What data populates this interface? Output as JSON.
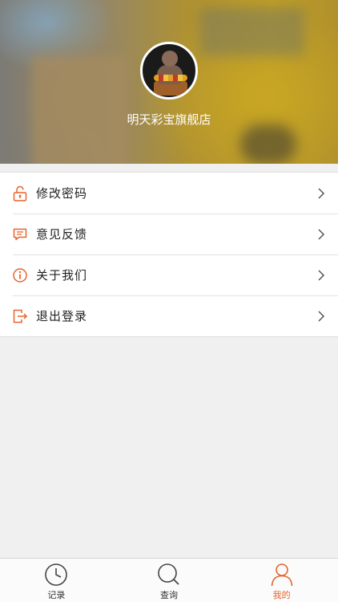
{
  "profile": {
    "store_name": "明天彩宝旗舰店"
  },
  "menu": {
    "items": [
      {
        "label": "修改密码",
        "icon": "unlock-icon"
      },
      {
        "label": "意见反馈",
        "icon": "message-icon"
      },
      {
        "label": "关于我们",
        "icon": "info-icon"
      },
      {
        "label": "退出登录",
        "icon": "logout-icon"
      }
    ]
  },
  "tabbar": {
    "tabs": [
      {
        "label": "记录",
        "icon": "clock-icon",
        "active": false
      },
      {
        "label": "查询",
        "icon": "search-icon",
        "active": false
      },
      {
        "label": "我的",
        "icon": "user-icon",
        "active": true
      }
    ]
  },
  "colors": {
    "accent": "#e8642c",
    "background": "#f0f0f0"
  }
}
